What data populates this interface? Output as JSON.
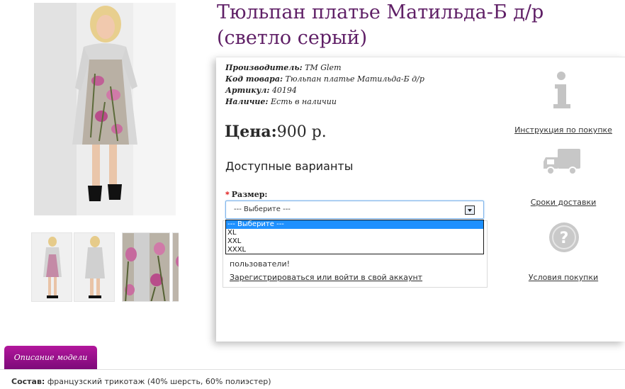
{
  "product": {
    "title": "Тюльпан платье Матильда-Б д/р (светло серый)",
    "meta": [
      {
        "label": "Производитель:",
        "value": "ТМ Glem"
      },
      {
        "label": "Код товара:",
        "value": "Тюльпан платье Матильда-Б д/р"
      },
      {
        "label": "Артикул:",
        "value": "40194"
      },
      {
        "label": "Наличие:",
        "value": "Есть в наличии"
      }
    ],
    "price_label": "Цена:",
    "price_value": "900 р.",
    "variants_heading": "Доступные варианты",
    "size": {
      "required_mark": "*",
      "label": "Размер:",
      "selected": "--- Выберите ---",
      "options": [
        "--- Выберите ---",
        "XL",
        "XXL",
        "XXXL"
      ]
    },
    "notice": {
      "text": "пользователи!",
      "link": "Зарегистрироваться или войти в свой аккаунт"
    }
  },
  "side_links": [
    {
      "icon": "info-icon",
      "label": "Инструкция по покупке"
    },
    {
      "icon": "delivery-truck-icon",
      "label": "Сроки доставки"
    },
    {
      "icon": "question-icon",
      "label": "Условия покупки"
    }
  ],
  "tabs": [
    {
      "label": "Описание модели",
      "active": true
    }
  ],
  "description": {
    "composition_label": "Состав:",
    "composition_value": "французский трикотаж (40% шерсть, 60% полиэстер)"
  },
  "colors": {
    "title": "#5f1f66",
    "tab_bg": "#9e108f",
    "select_highlight": "#1e90ff"
  }
}
